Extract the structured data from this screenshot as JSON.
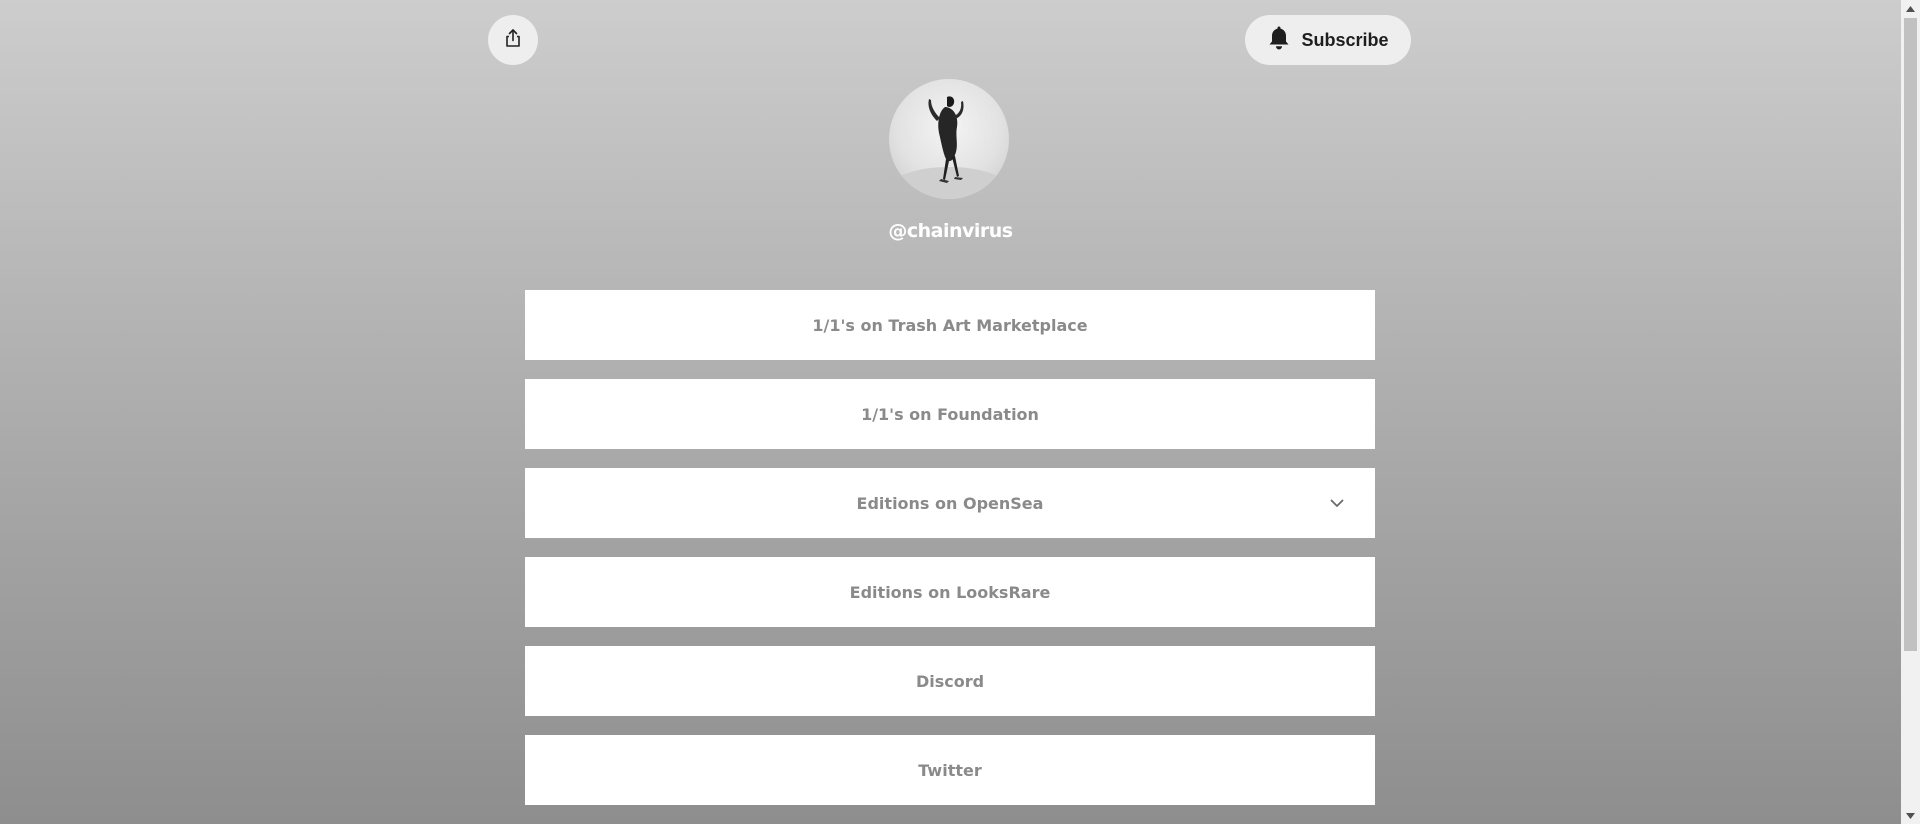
{
  "header": {
    "share_icon": "share-icon",
    "subscribe_icon": "bell-icon",
    "subscribe_label": "Subscribe"
  },
  "profile": {
    "username": "@chainvirus"
  },
  "links": [
    {
      "label": "1/1's on Trash Art Marketplace",
      "expandable": false
    },
    {
      "label": "1/1's on Foundation",
      "expandable": false
    },
    {
      "label": "Editions on OpenSea",
      "expandable": true
    },
    {
      "label": "Editions on LooksRare",
      "expandable": false
    },
    {
      "label": "Discord",
      "expandable": false
    },
    {
      "label": "Twitter",
      "expandable": false
    }
  ],
  "colors": {
    "card_background": "#ffffff",
    "card_text": "#8a8a8a",
    "username_text": "#ffffff",
    "button_background": "#eeeeee"
  }
}
